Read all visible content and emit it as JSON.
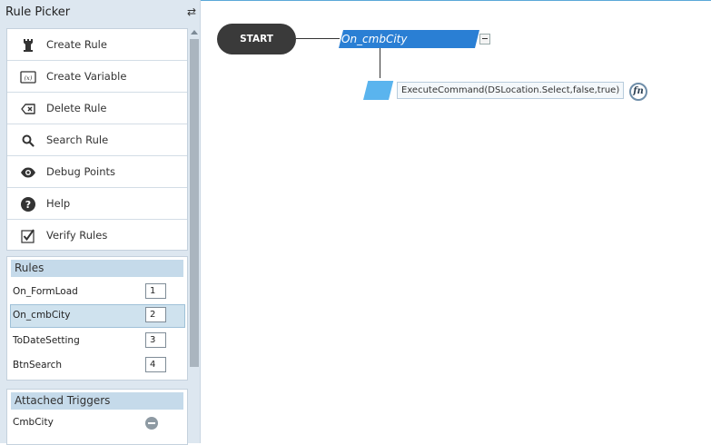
{
  "panel": {
    "title": "Rule Picker",
    "actions": [
      {
        "label": "Create Rule",
        "icon": "rook-icon"
      },
      {
        "label": "Create Variable",
        "icon": "variable-icon"
      },
      {
        "label": "Delete Rule",
        "icon": "backspace-icon"
      },
      {
        "label": "Search Rule",
        "icon": "search-icon"
      },
      {
        "label": "Debug Points",
        "icon": "eye-icon"
      },
      {
        "label": "Help",
        "icon": "help-icon"
      },
      {
        "label": "Verify Rules",
        "icon": "checkbox-icon"
      }
    ],
    "rules": {
      "heading": "Rules",
      "items": [
        {
          "name": "On_FormLoad",
          "order": "1"
        },
        {
          "name": "On_cmbCity",
          "order": "2",
          "selected": true
        },
        {
          "name": "ToDateSetting",
          "order": "3"
        },
        {
          "name": "BtnSearch",
          "order": "4"
        }
      ]
    },
    "triggers": {
      "heading": "Attached Triggers",
      "items": [
        {
          "name": "CmbCity"
        }
      ]
    }
  },
  "canvas": {
    "start_label": "START",
    "rule_label": "On_cmbCity",
    "action_expression": "ExecuteCommand(DSLocation.Select,false,true)",
    "fn_label": "fn"
  }
}
